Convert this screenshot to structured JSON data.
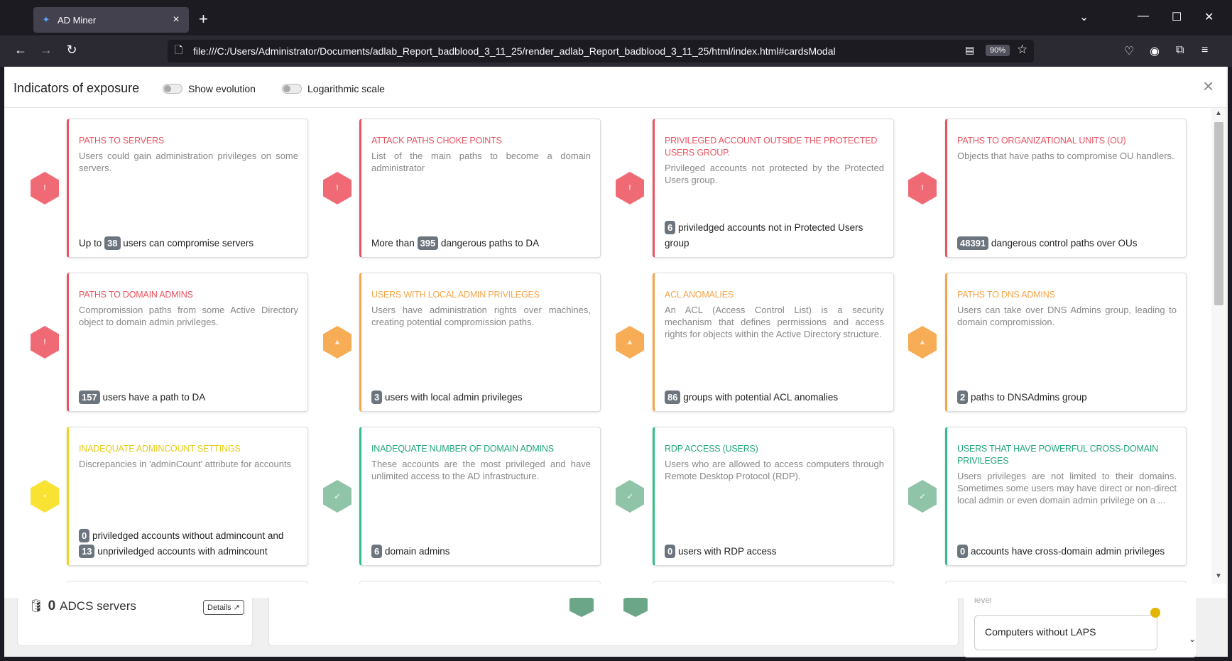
{
  "browser": {
    "tab_title": "AD Miner",
    "tab_favicon": "admin-favicon",
    "url": "file:///C:/Users/Administrator/Documents/adlab_Report_badblood_3_11_25/render_adlab_Report_badblood_3_11_25/html/index.html#cardsModal",
    "zoom": "90%"
  },
  "background": {
    "adcs_count": "0",
    "adcs_label": "ADCS servers",
    "details_label": "Details",
    "level_label": "level",
    "laps_label": "Computers without LAPS"
  },
  "modal": {
    "title": "Indicators of exposure",
    "toggle_evolution": "Show evolution",
    "toggle_log": "Logarithmic scale",
    "close_glyph": "×"
  },
  "cards": [
    {
      "severity": "red",
      "title": "PATHS TO SERVERS",
      "desc": "Users could gain administration privileges on some servers.",
      "pre": "Up to",
      "count": "38",
      "post": "users can compromise servers",
      "count2": "",
      "post2": ""
    },
    {
      "severity": "red",
      "title": "ATTACK PATHS CHOKE POINTS",
      "desc": "List of the main paths to become a domain administrator",
      "pre": "More than",
      "count": "395",
      "post": "dangerous paths to DA",
      "count2": "",
      "post2": ""
    },
    {
      "severity": "red",
      "title": "PRIVILEGED ACCOUNT OUTSIDE THE PROTECTED USERS GROUP.",
      "desc": "Privileged accounts not protected by the Protected Users group.",
      "pre": "",
      "count": "6",
      "post": "priviledged accounts not in Protected Users group",
      "count2": "",
      "post2": ""
    },
    {
      "severity": "red",
      "title": "PATHS TO ORGANIZATIONAL UNITS (OU)",
      "desc": "Objects that have paths to compromise OU handlers.",
      "pre": "",
      "count": "48391",
      "post": "dangerous control paths over OUs",
      "count2": "",
      "post2": ""
    },
    {
      "severity": "red",
      "title": "PATHS TO DOMAIN ADMINS",
      "desc": "Compromission paths from some Active Directory object to domain admin privileges.",
      "pre": "",
      "count": "157",
      "post": "users have a path to DA",
      "count2": "",
      "post2": ""
    },
    {
      "severity": "orange",
      "title": "USERS WITH LOCAL ADMIN PRIVILEGES",
      "desc": "Users have administration rights over machines, creating potential compromission paths.",
      "pre": "",
      "count": "3",
      "post": "users with local admin privileges",
      "count2": "",
      "post2": ""
    },
    {
      "severity": "orange",
      "title": "ACL ANOMALIES",
      "desc": "An ACL (Access Control List) is a security mechanism that defines permissions and access rights for objects within the Active Directory structure.",
      "pre": "",
      "count": "86",
      "post": "groups with potential ACL anomalies",
      "count2": "",
      "post2": ""
    },
    {
      "severity": "orange",
      "title": "PATHS TO DNS ADMINS",
      "desc": "Users can take over DNS Admins group, leading to domain compromission.",
      "pre": "",
      "count": "2",
      "post": "paths to DNSAdmins group",
      "count2": "",
      "post2": ""
    },
    {
      "severity": "yellow",
      "title": "INADEQUATE ADMINCOUNT SETTINGS",
      "desc": "Discrepancies in 'adminCount' attribute for accounts",
      "pre": "",
      "count": "0",
      "post": "priviledged accounts without admincount and",
      "count2": "13",
      "post2": "unpriviledged accounts with admincount"
    },
    {
      "severity": "green",
      "title": "INADEQUATE NUMBER OF DOMAIN ADMINS",
      "desc": "These accounts are the most privileged and have unlimited access to the AD infrastructure.",
      "pre": "",
      "count": "6",
      "post": "domain admins",
      "count2": "",
      "post2": ""
    },
    {
      "severity": "green",
      "title": "RDP ACCESS (USERS)",
      "desc": "Users who are allowed to access computers through Remote Desktop Protocol (RDP).",
      "pre": "",
      "count": "0",
      "post": "users with RDP access",
      "count2": "",
      "post2": ""
    },
    {
      "severity": "green",
      "title": "USERS THAT HAVE POWERFUL CROSS-DOMAIN PRIVILEGES",
      "desc": "Users privileges are not limited to their domains. Sometimes some users may have direct or non-direct local admin or even domain admin privilege on a ...",
      "pre": "",
      "count": "0",
      "post": "accounts have cross-domain admin privileges",
      "count2": "",
      "post2": ""
    }
  ],
  "colors": {
    "red": "#e85361",
    "orange": "#f5a64b",
    "yellow": "#f0d41e",
    "green": "#2fbf89"
  },
  "icons": {
    "red": "critical-hexagon-icon",
    "orange": "warning-hexagon-icon",
    "yellow": "minor-hexagon-icon",
    "green": "ok-hexagon-icon"
  }
}
